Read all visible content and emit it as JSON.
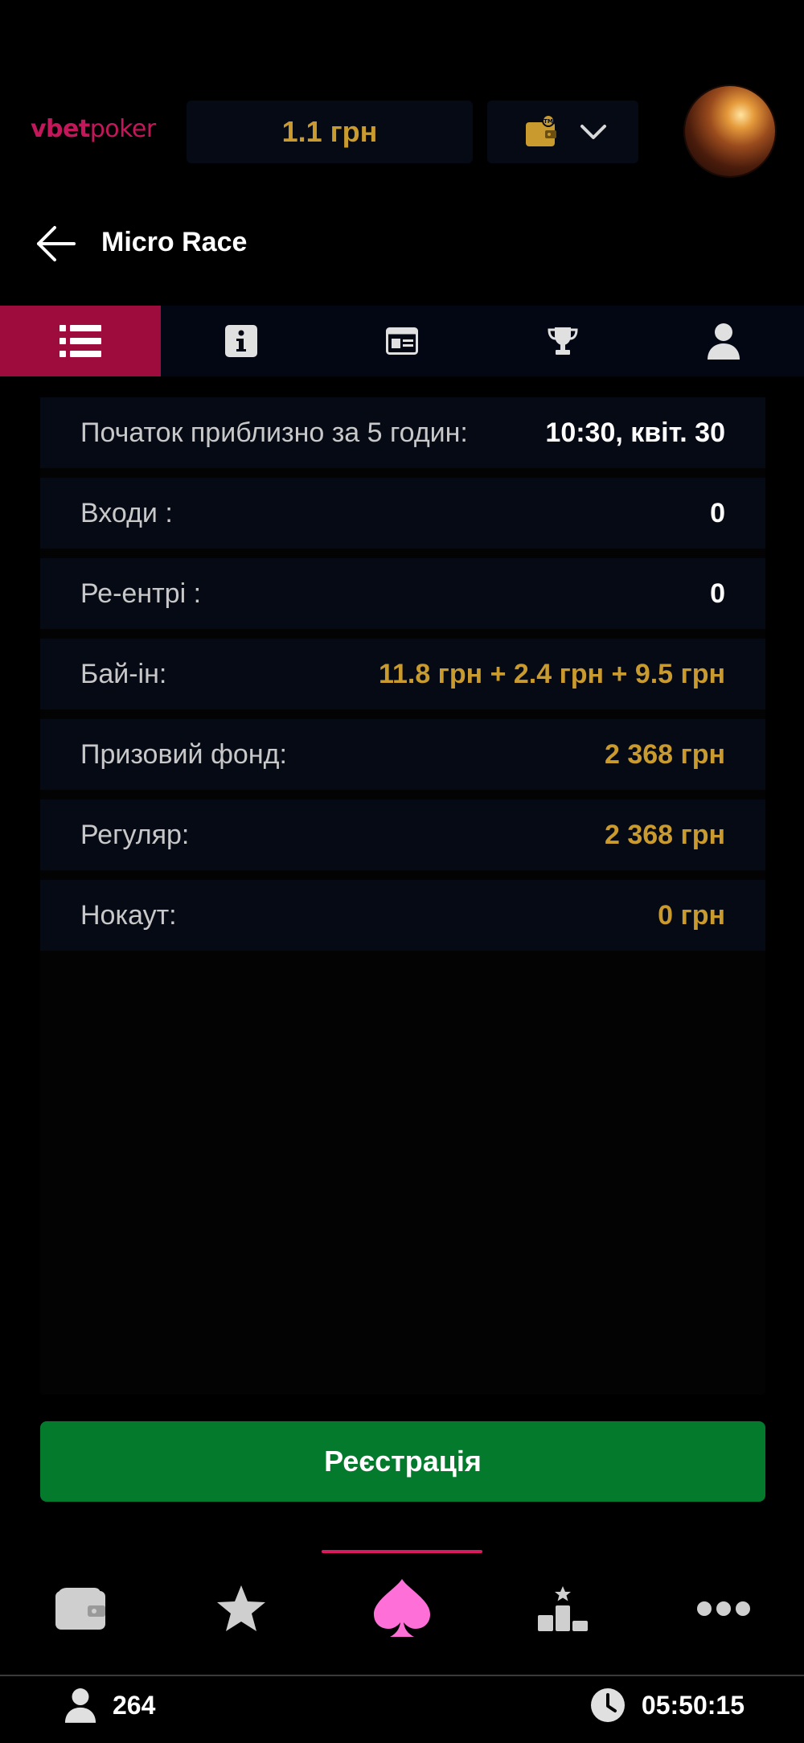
{
  "header": {
    "logo_bold": "vbet",
    "logo_light": "poker",
    "balance": "1.1 грн"
  },
  "title": "Micro Race",
  "tabs": [
    {
      "icon": "list-icon",
      "active": true
    },
    {
      "icon": "info-icon",
      "active": false
    },
    {
      "icon": "id-card-icon",
      "active": false
    },
    {
      "icon": "trophy-icon",
      "active": false
    },
    {
      "icon": "user-icon",
      "active": false
    }
  ],
  "info": {
    "start_label": "Початок приблизно за 5 годин:",
    "start_value": "10:30, квіт. 30",
    "entries_label": "Входи :",
    "entries_value": "0",
    "reentries_label": "Ре-ентрі :",
    "reentries_value": "0",
    "buyin_label": "Бай-ін:",
    "buyin_value": "11.8 грн + 2.4 грн + 9.5 грн",
    "prizepool_label": "Призовий фонд:",
    "prizepool_value": "2 368 грн",
    "regular_label": "Регуляр:",
    "regular_value": "2 368 грн",
    "knockout_label": "Нокаут:",
    "knockout_value": "0 грн"
  },
  "register_label": "Реєстрація",
  "bottom_nav": [
    {
      "icon": "wallet-icon",
      "active": false
    },
    {
      "icon": "star-icon",
      "active": false
    },
    {
      "icon": "spade-icon",
      "active": true
    },
    {
      "icon": "leaderboard-icon",
      "active": false
    },
    {
      "icon": "more-icon",
      "active": false
    }
  ],
  "status": {
    "players_online": "264",
    "time": "05:50:15"
  },
  "colors": {
    "brand": "#c2185b",
    "active_tab": "#9d0c3d",
    "gold": "#c99a2e",
    "register_green": "#047a2c",
    "spade_active": "#ff6fd8"
  }
}
